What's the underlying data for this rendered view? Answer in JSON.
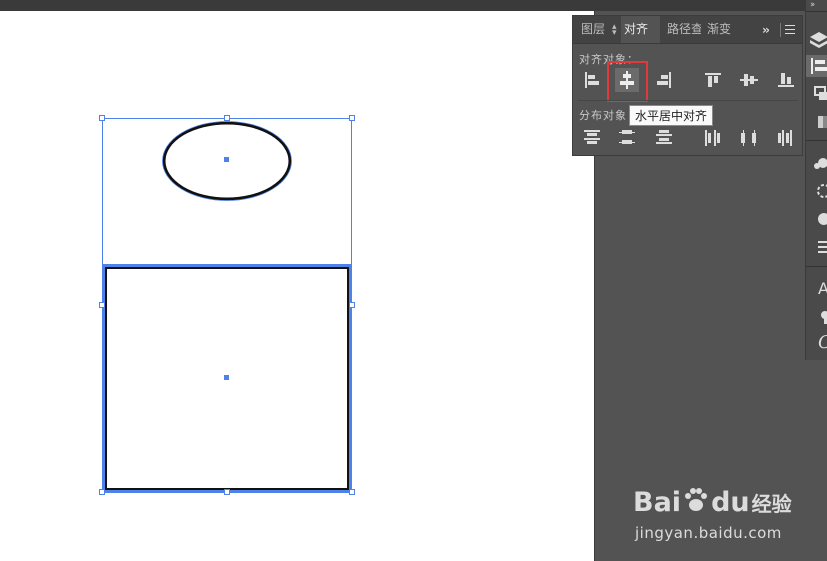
{
  "panel": {
    "tabs": [
      {
        "label": "图层"
      },
      {
        "label": "对齐"
      },
      {
        "label": "路径查"
      },
      {
        "label": "渐变"
      }
    ],
    "section_align_label": "对齐对象：",
    "section_distribute_label": "分布对象：",
    "tooltip": "水平居中对齐",
    "align_buttons": [
      "align-left-icon",
      "align-horizontal-center-icon",
      "align-right-icon",
      "align-top-icon",
      "align-vertical-center-icon",
      "align-bottom-icon"
    ],
    "distribute_buttons": [
      "distribute-top-icon",
      "distribute-vertical-center-icon",
      "distribute-bottom-icon",
      "distribute-left-icon",
      "distribute-horizontal-center-icon",
      "distribute-right-icon"
    ]
  },
  "watermark": {
    "brand_left": "Bai",
    "brand_right": "du",
    "brand_cn": "经验",
    "url": "jingyan.baidu.com"
  },
  "colors": {
    "selection": "#4e82e8",
    "highlight": "#e23a3a",
    "panel_bg": "#535353"
  }
}
